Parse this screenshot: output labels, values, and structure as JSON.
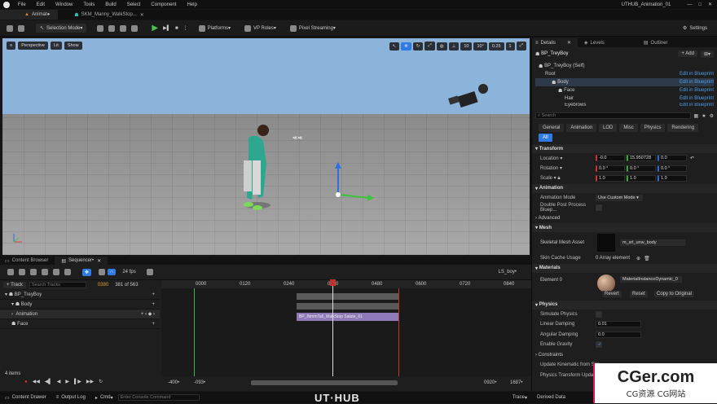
{
  "menu": {
    "items": [
      "File",
      "Edit",
      "Window",
      "Tools",
      "Build",
      "Select",
      "Component",
      "Help"
    ],
    "project": "UTHUB_Animation_01"
  },
  "tabs": {
    "level": "Animat●",
    "asset": "SKM_Manny_WalkStop..."
  },
  "toolbar": {
    "mode": "Selection Mode",
    "platforms": "Platforms",
    "vp_roles": "VP Roles",
    "pixel_streaming": "Pixel Streaming",
    "settings": "Settings"
  },
  "viewport": {
    "perspective": "Perspective",
    "lit": "Lit",
    "show": "Show",
    "grid": "10",
    "angle": "10°",
    "scale": "0.25",
    "speed": "1"
  },
  "sequencer": {
    "tab_content": "Content Browser",
    "tab_seq": "Sequencer•",
    "fps": "24 fps",
    "sequence_name": "LS_boy•",
    "add_track": "Track",
    "search_placeholder": "Search Tracks",
    "frame_current": "0380",
    "frame_range": "381 of 563",
    "tracks": [
      {
        "name": "BP_TreyBoy",
        "indent": 0
      },
      {
        "name": "Body",
        "indent": 1
      },
      {
        "name": "Animation",
        "indent": 2
      },
      {
        "name": "Face",
        "indent": 1
      }
    ],
    "ticks": [
      "0000",
      "0120",
      "0240",
      "0360",
      "0480",
      "0600",
      "0720",
      "0840"
    ],
    "clip_label": "BP_BtmmTall_WalkStop Salute_01",
    "items_count": "4 items",
    "range_left": "-400•",
    "range_left2": "-093•",
    "range_right": "0920•",
    "range_right2": "1687•"
  },
  "details": {
    "tab_details": "Details",
    "tab_levels": "Levels",
    "tab_outliner": "Outliner",
    "object": "BP_TreyBoy",
    "add_label": "Add",
    "tree": [
      {
        "name": "BP_TreyBoy (Self)",
        "link": ""
      },
      {
        "name": "Root",
        "link": "Edit in Blueprint"
      },
      {
        "name": "Body",
        "link": "Edit in Blueprint"
      },
      {
        "name": "Face",
        "link": "Edit in Blueprint"
      },
      {
        "name": "Hair",
        "link": "Edit in Blueprint"
      },
      {
        "name": "Eyebrows",
        "link": "Edit in Blueprint"
      }
    ],
    "search_placeholder": "Search",
    "filters": [
      "General",
      "Animation",
      "LOD",
      "Misc",
      "Physics",
      "Rendering"
    ],
    "filter_all": "All",
    "transform": {
      "section": "Transform",
      "location": {
        "label": "Location",
        "x": "-0.0",
        "y": "15.950728",
        "z": "0.0"
      },
      "rotation": {
        "label": "Rotation",
        "x": "0.0 °",
        "y": "0.0 °",
        "z": "0.0 °"
      },
      "scale": {
        "label": "Scale",
        "x": "1.0",
        "y": "1.0",
        "z": "1.0"
      }
    },
    "animation": {
      "section": "Animation",
      "mode_label": "Animation Mode",
      "mode_value": "Use Custom Mode",
      "double_label": "Double Post Process Bluep...",
      "advanced": "Advanced"
    },
    "mesh": {
      "section": "Mesh",
      "label": "Skeletal Mesh Asset",
      "value": "m_srl_unw_body",
      "cache_label": "Skin Cache Usage",
      "cache_value": "0 Array element"
    },
    "materials": {
      "section": "Materials",
      "element": "Element 0",
      "value": "MaterialInstanceDynamic_0",
      "revert": "Revert",
      "reset": "Reset",
      "copy": "Copy to Original"
    },
    "physics": {
      "section": "Physics",
      "simulate": "Simulate Physics",
      "linear": "Linear Damping",
      "linear_val": "0.01",
      "angular": "Angular Damping",
      "angular_val": "0.0",
      "gravity": "Enable Gravity"
    },
    "constraints": "Constraints",
    "kinematic": "Update Kinematic from Sim...",
    "transform_update": "Physics Transform Update..."
  },
  "statusbar": {
    "drawer": "Content Drawer",
    "output": "Output Log",
    "cmd": "Cmd",
    "console_placeholder": "Enter Console Command",
    "trace": "Trace",
    "derived": "Derived Data"
  },
  "watermark": {
    "brand": "UT·HUB",
    "site": "CGer.com",
    "site_sub": "CG资源 CG网站"
  },
  "colors": {
    "accent": "#2f7ae5",
    "playhead": "#c4302b",
    "track_green": "#3cb64a",
    "clip": "#8d7ab6"
  }
}
